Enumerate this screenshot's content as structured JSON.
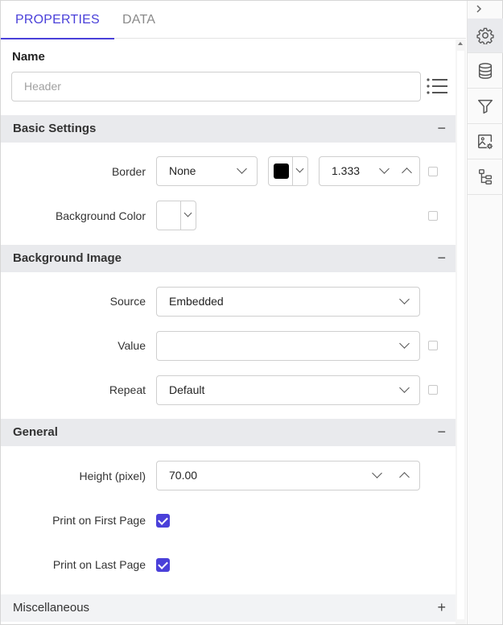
{
  "tabs": [
    {
      "label": "PROPERTIES",
      "active": true
    },
    {
      "label": "DATA",
      "active": false
    }
  ],
  "name": {
    "label": "Name",
    "placeholder": "Header"
  },
  "sections": {
    "basic": {
      "title": "Basic Settings",
      "toggle": "−"
    },
    "background_image": {
      "title": "Background Image",
      "toggle": "−"
    },
    "general": {
      "title": "General",
      "toggle": "−"
    },
    "misc": {
      "title": "Miscellaneous",
      "toggle": "+"
    }
  },
  "basic": {
    "border_label": "Border",
    "border_style": "None",
    "border_color": "#000000",
    "border_width": "1.333",
    "background_color_label": "Background Color"
  },
  "background_image": {
    "source_label": "Source",
    "source_value": "Embedded",
    "value_label": "Value",
    "value_value": "",
    "repeat_label": "Repeat",
    "repeat_value": "Default"
  },
  "general": {
    "height_label": "Height (pixel)",
    "height_value": "70.00",
    "print_first_label": "Print on First Page",
    "print_first_checked": true,
    "print_last_label": "Print on Last Page",
    "print_last_checked": true
  },
  "sidebar": {
    "collapse_icon": "chevron-right-icon",
    "items": [
      {
        "icon": "gear-icon",
        "active": true
      },
      {
        "icon": "database-icon",
        "active": false
      },
      {
        "icon": "filter-icon",
        "active": false
      },
      {
        "icon": "image-settings-icon",
        "active": false
      },
      {
        "icon": "tree-structure-icon",
        "active": false
      }
    ]
  },
  "colors": {
    "accent": "#4a40d9",
    "section_bg": "#e9eaed"
  }
}
